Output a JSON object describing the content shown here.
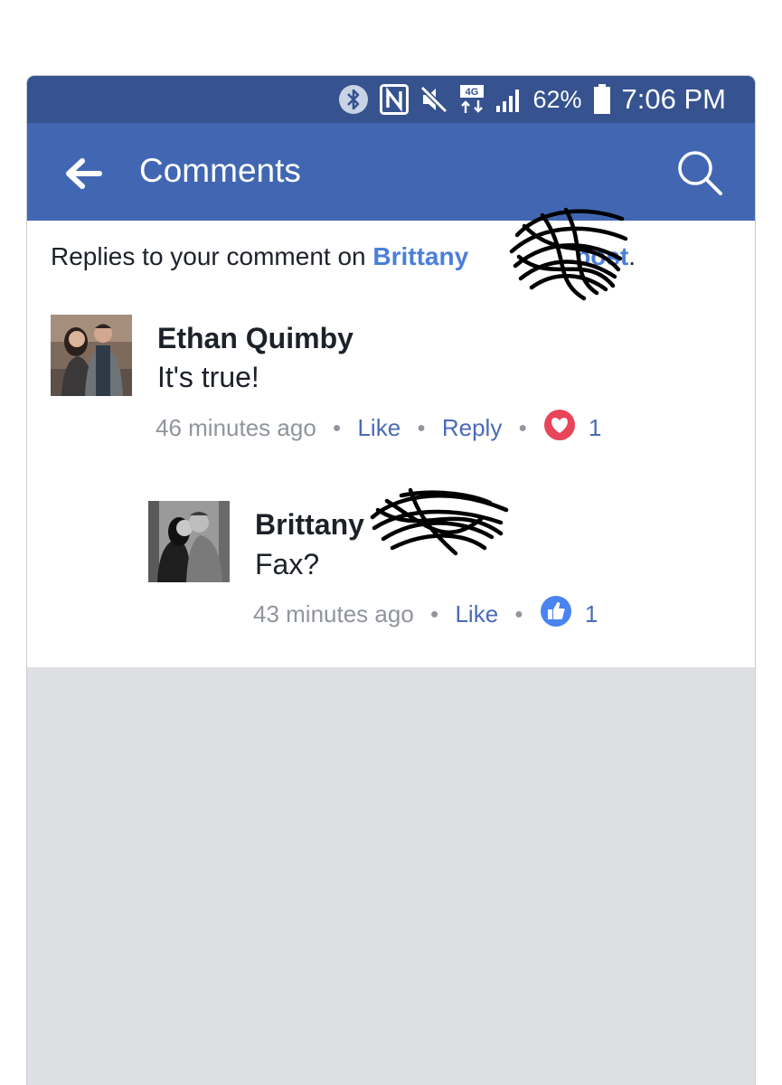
{
  "status_bar": {
    "battery_percent": "62%",
    "time": "7:06 PM",
    "network": "4G",
    "icons": [
      "bluetooth-icon",
      "nfc-icon",
      "mute-icon",
      "network-icon",
      "signal-icon",
      "battery-icon"
    ]
  },
  "header": {
    "title": "Comments",
    "back_icon": "back-arrow-icon",
    "search_icon": "search-icon"
  },
  "context": {
    "prefix": "Replies to your comment on ",
    "author_link": "Brittany",
    "post_link": "post",
    "suffix": "."
  },
  "comments": [
    {
      "author": "Ethan Quimby",
      "text": "It's true!",
      "time": "46 minutes ago",
      "like_label": "Like",
      "reply_label": "Reply",
      "reaction": "love",
      "reaction_count": "1"
    },
    {
      "author": "Brittany",
      "text": "Fax?",
      "time": "43 minutes ago",
      "like_label": "Like",
      "reaction": "like",
      "reaction_count": "1"
    }
  ],
  "colors": {
    "status_bar": "#36528f",
    "app_bar": "#4267b2",
    "link": "#4a7fd8",
    "love": "#e8445a",
    "like": "#4a84f0",
    "page_bg": "#dddfe3"
  }
}
